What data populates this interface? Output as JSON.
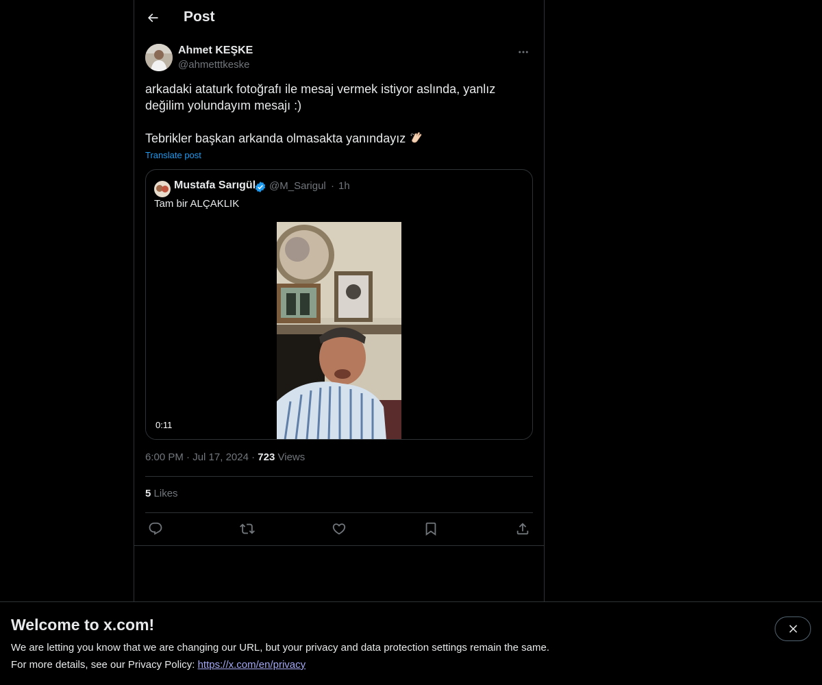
{
  "header": {
    "title": "Post",
    "back_icon": "arrow-left-icon"
  },
  "author": {
    "name": "Ahmet KEŞKE",
    "handle": "@ahmetttkeske",
    "more_icon": "more-horizontal-icon"
  },
  "tweet": {
    "line1": "arkadaki ataturk fotoğrafı ile mesaj vermek istiyor aslında, yanlız",
    "line2": "değilim yolundayım mesajı :)",
    "line3": "Tebrikler başkan arkanda olmasakta yanındayız",
    "emoji": "clapping-hands-icon",
    "translate": "Translate post"
  },
  "quote": {
    "name": "Mustafa Sarıgül",
    "verified_icon": "verified-badge-icon",
    "handle": "@M_Sarigul",
    "dot": "·",
    "time": "1h",
    "text": "Tam bir ALÇAKLIK",
    "video_duration": "0:11"
  },
  "meta": {
    "time": "6:00 PM",
    "sep1": "·",
    "date": "Jul 17, 2024",
    "sep2": "·",
    "views_count": "723",
    "views_label": "Views"
  },
  "likes": {
    "count": "5",
    "label": "Likes"
  },
  "actions": [
    "reply-icon",
    "repost-icon",
    "like-icon",
    "bookmark-icon",
    "share-icon"
  ],
  "banner": {
    "title": "Welcome to x.com!",
    "line1": "We are letting you know that we are changing our URL, but your privacy and data protection settings remain the same.",
    "line2_prefix": "For more details, see our Privacy Policy: ",
    "link": "https://x.com/en/privacy",
    "close_icon": "close-icon"
  },
  "colors": {
    "background": "#000000",
    "text": "#e7e9ea",
    "muted": "#71767b",
    "accent": "#1d9bf0",
    "border": "#2f3336"
  }
}
